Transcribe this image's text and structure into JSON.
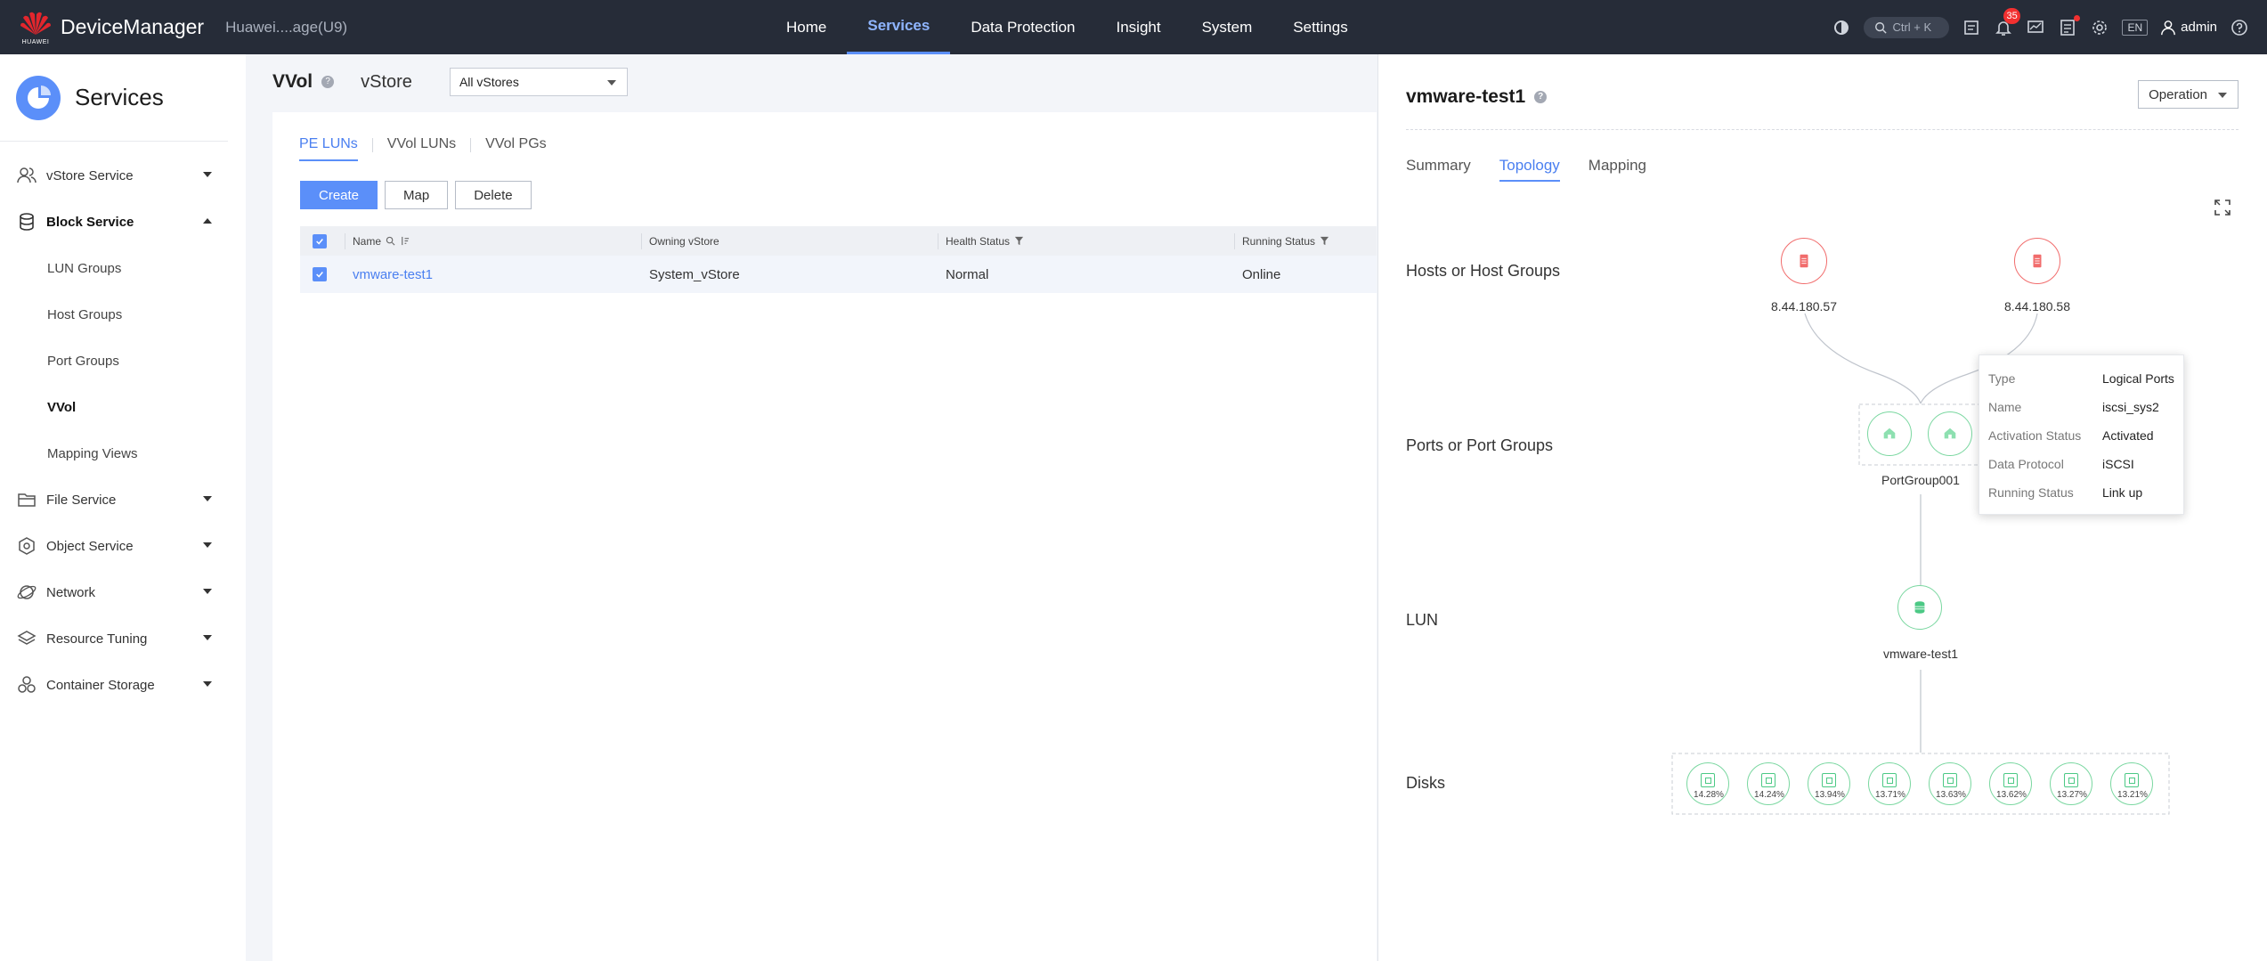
{
  "header": {
    "logo_text": "HUAWEI",
    "brand": "DeviceManager",
    "device": "Huawei....age(U9)",
    "nav": [
      "Home",
      "Services",
      "Data Protection",
      "Insight",
      "System",
      "Settings"
    ],
    "active_nav": "Services",
    "search_shortcut": "Ctrl + K",
    "alarm_count": "35",
    "language": "EN",
    "user": "admin"
  },
  "sidebar": {
    "title": "Services",
    "items": [
      {
        "label": "vStore Service"
      },
      {
        "label": "Block Service"
      },
      {
        "label": "LUN Groups"
      },
      {
        "label": "Host Groups"
      },
      {
        "label": "Port Groups"
      },
      {
        "label": "VVol"
      },
      {
        "label": "Mapping Views"
      },
      {
        "label": "File Service"
      },
      {
        "label": "Object Service"
      },
      {
        "label": "Network"
      },
      {
        "label": "Resource Tuning"
      },
      {
        "label": "Container Storage"
      }
    ]
  },
  "main": {
    "title": "VVol",
    "help": "?",
    "vstore_label": "vStore",
    "vstore_value": "All vStores",
    "tabs": [
      "PE LUNs",
      "VVol LUNs",
      "VVol PGs"
    ],
    "buttons": [
      "Create",
      "Map",
      "Delete"
    ],
    "columns": [
      "Name",
      "Owning vStore",
      "Health Status",
      "Running Status"
    ],
    "rows": [
      {
        "name": "vmware-test1",
        "vstore": "System_vStore",
        "health": "Normal",
        "running": "Online"
      }
    ]
  },
  "panel": {
    "title": "vmware-test1",
    "operation": "Operation",
    "tabs": [
      "Summary",
      "Topology",
      "Mapping"
    ],
    "rows": [
      "Hosts or Host Groups",
      "Ports or Port Groups",
      "LUN",
      "Disks"
    ],
    "hosts": [
      "8.44.180.57",
      "8.44.180.58"
    ],
    "port_group": "PortGroup001",
    "lun": "vmware-test1",
    "disks": [
      "14.28%",
      "14.24%",
      "13.94%",
      "13.71%",
      "13.63%",
      "13.62%",
      "13.27%",
      "13.21%"
    ],
    "tooltip": [
      {
        "k": "Type",
        "v": "Logical Ports"
      },
      {
        "k": "Name",
        "v": "iscsi_sys2"
      },
      {
        "k": "Activation Status",
        "v": "Activated"
      },
      {
        "k": "Data Protocol",
        "v": "iSCSI"
      },
      {
        "k": "Running Status",
        "v": "Link up"
      }
    ]
  },
  "colors": {
    "accent": "#5b8ff9",
    "topbar": "#262c38",
    "host": "#f16c6c",
    "ok": "#4cc985"
  }
}
